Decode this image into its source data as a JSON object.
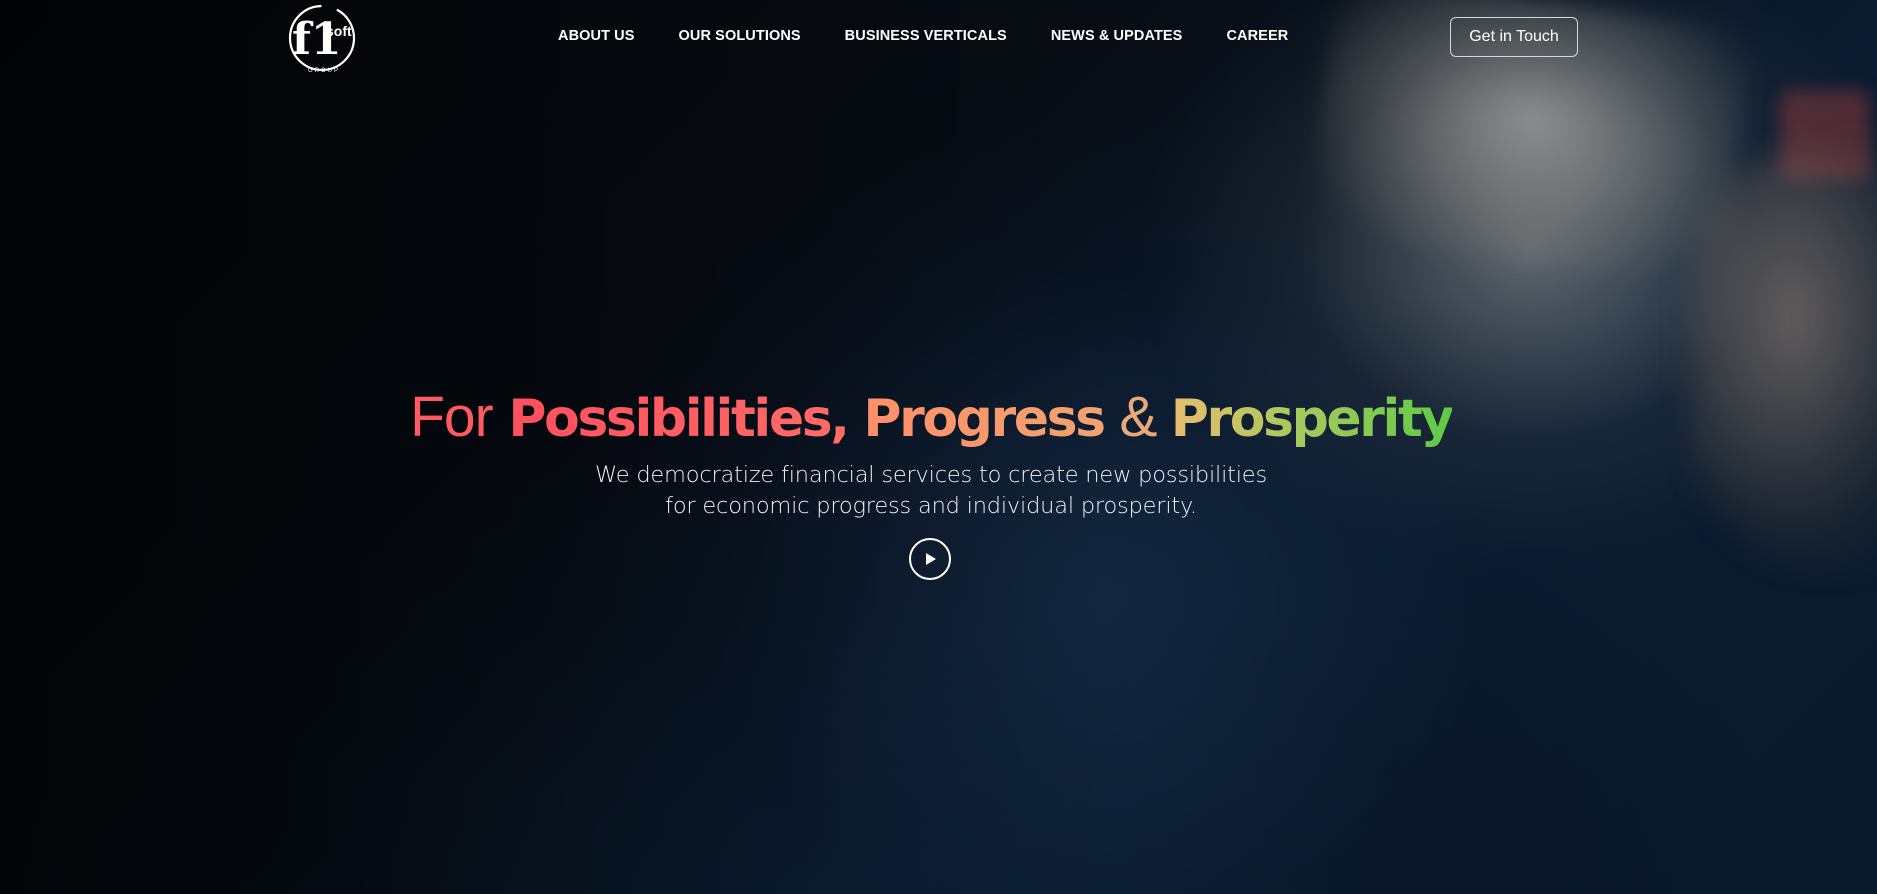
{
  "brand": {
    "logo_main": "f1",
    "logo_soft": "soft",
    "logo_group": "GROUP",
    "icon": "f1soft-logo"
  },
  "nav": {
    "items": [
      {
        "label": "ABOUT US"
      },
      {
        "label": "OUR SOLUTIONS"
      },
      {
        "label": "BUSINESS VERTICALS"
      },
      {
        "label": "NEWS & UPDATES"
      },
      {
        "label": "CAREER"
      }
    ],
    "cta_label": "Get in Touch"
  },
  "hero": {
    "headline": {
      "for": "For",
      "word1": "Possibilities",
      "comma": ",",
      "word2": "Progress",
      "amp": "&",
      "word3": "Prosperity"
    },
    "subtitle_line1": "We democratize financial services to create new possibilities",
    "subtitle_line2": "for economic progress and individual prosperity.",
    "play_icon": "play-icon"
  },
  "colors": {
    "for": "#ff5a5f",
    "possibilities": "#ff4f5d",
    "progress": "#f1a36e",
    "prosperity_start": "#e8bd70",
    "prosperity_end": "#5dcb45"
  }
}
